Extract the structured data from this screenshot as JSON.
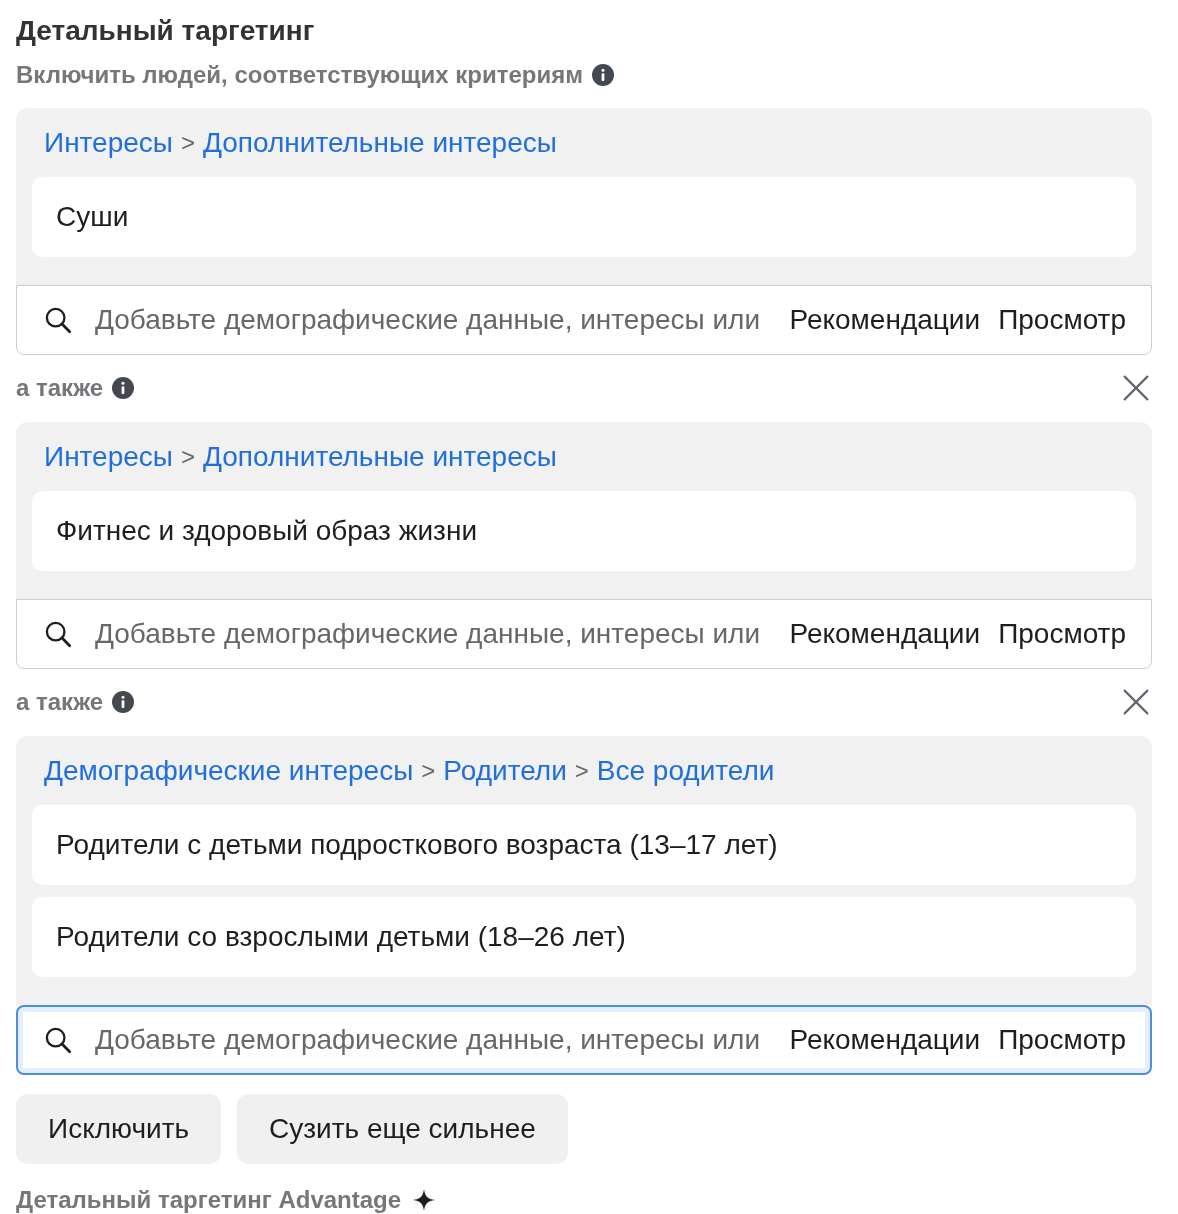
{
  "title": "Детальный таргетинг",
  "include_label": "Включить людей, соответствующих критериям",
  "groups": [
    {
      "breadcrumb": [
        {
          "kind": "link",
          "text": "Интересы"
        },
        {
          "kind": "separator",
          "text": ">"
        },
        {
          "kind": "link",
          "text": "Дополнительные интересы"
        }
      ],
      "items": [
        "Суши"
      ],
      "search": {
        "placeholder": "Добавьте демографические данные, интересы или",
        "focused": false,
        "actions": [
          "Рекомендации",
          "Просмотр"
        ]
      }
    },
    {
      "connector": "а также",
      "breadcrumb": [
        {
          "kind": "link",
          "text": "Интересы"
        },
        {
          "kind": "separator",
          "text": ">"
        },
        {
          "kind": "link",
          "text": "Дополнительные интересы"
        }
      ],
      "items": [
        "Фитнес и здоровый образ жизни"
      ],
      "search": {
        "placeholder": "Добавьте демографические данные, интересы или",
        "focused": false,
        "actions": [
          "Рекомендации",
          "Просмотр"
        ]
      }
    },
    {
      "connector": "а также",
      "breadcrumb": [
        {
          "kind": "link",
          "text": "Демографические интересы"
        },
        {
          "kind": "separator",
          "text": ">"
        },
        {
          "kind": "link",
          "text": "Родители"
        },
        {
          "kind": "separator",
          "text": ">"
        },
        {
          "kind": "link",
          "text": "Все родители"
        }
      ],
      "items": [
        "Родители с детьми подросткового возраста (13–17 лет)",
        "Родители со взрослыми детьми (18–26 лет)"
      ],
      "search": {
        "placeholder": "Добавьте демографические данные, интересы или",
        "focused": true,
        "actions": [
          "Рекомендации",
          "Просмотр"
        ]
      }
    }
  ],
  "buttons": [
    "Исключить",
    "Сузить еще сильнее"
  ],
  "advantage_label": "Детальный таргетинг Advantage"
}
